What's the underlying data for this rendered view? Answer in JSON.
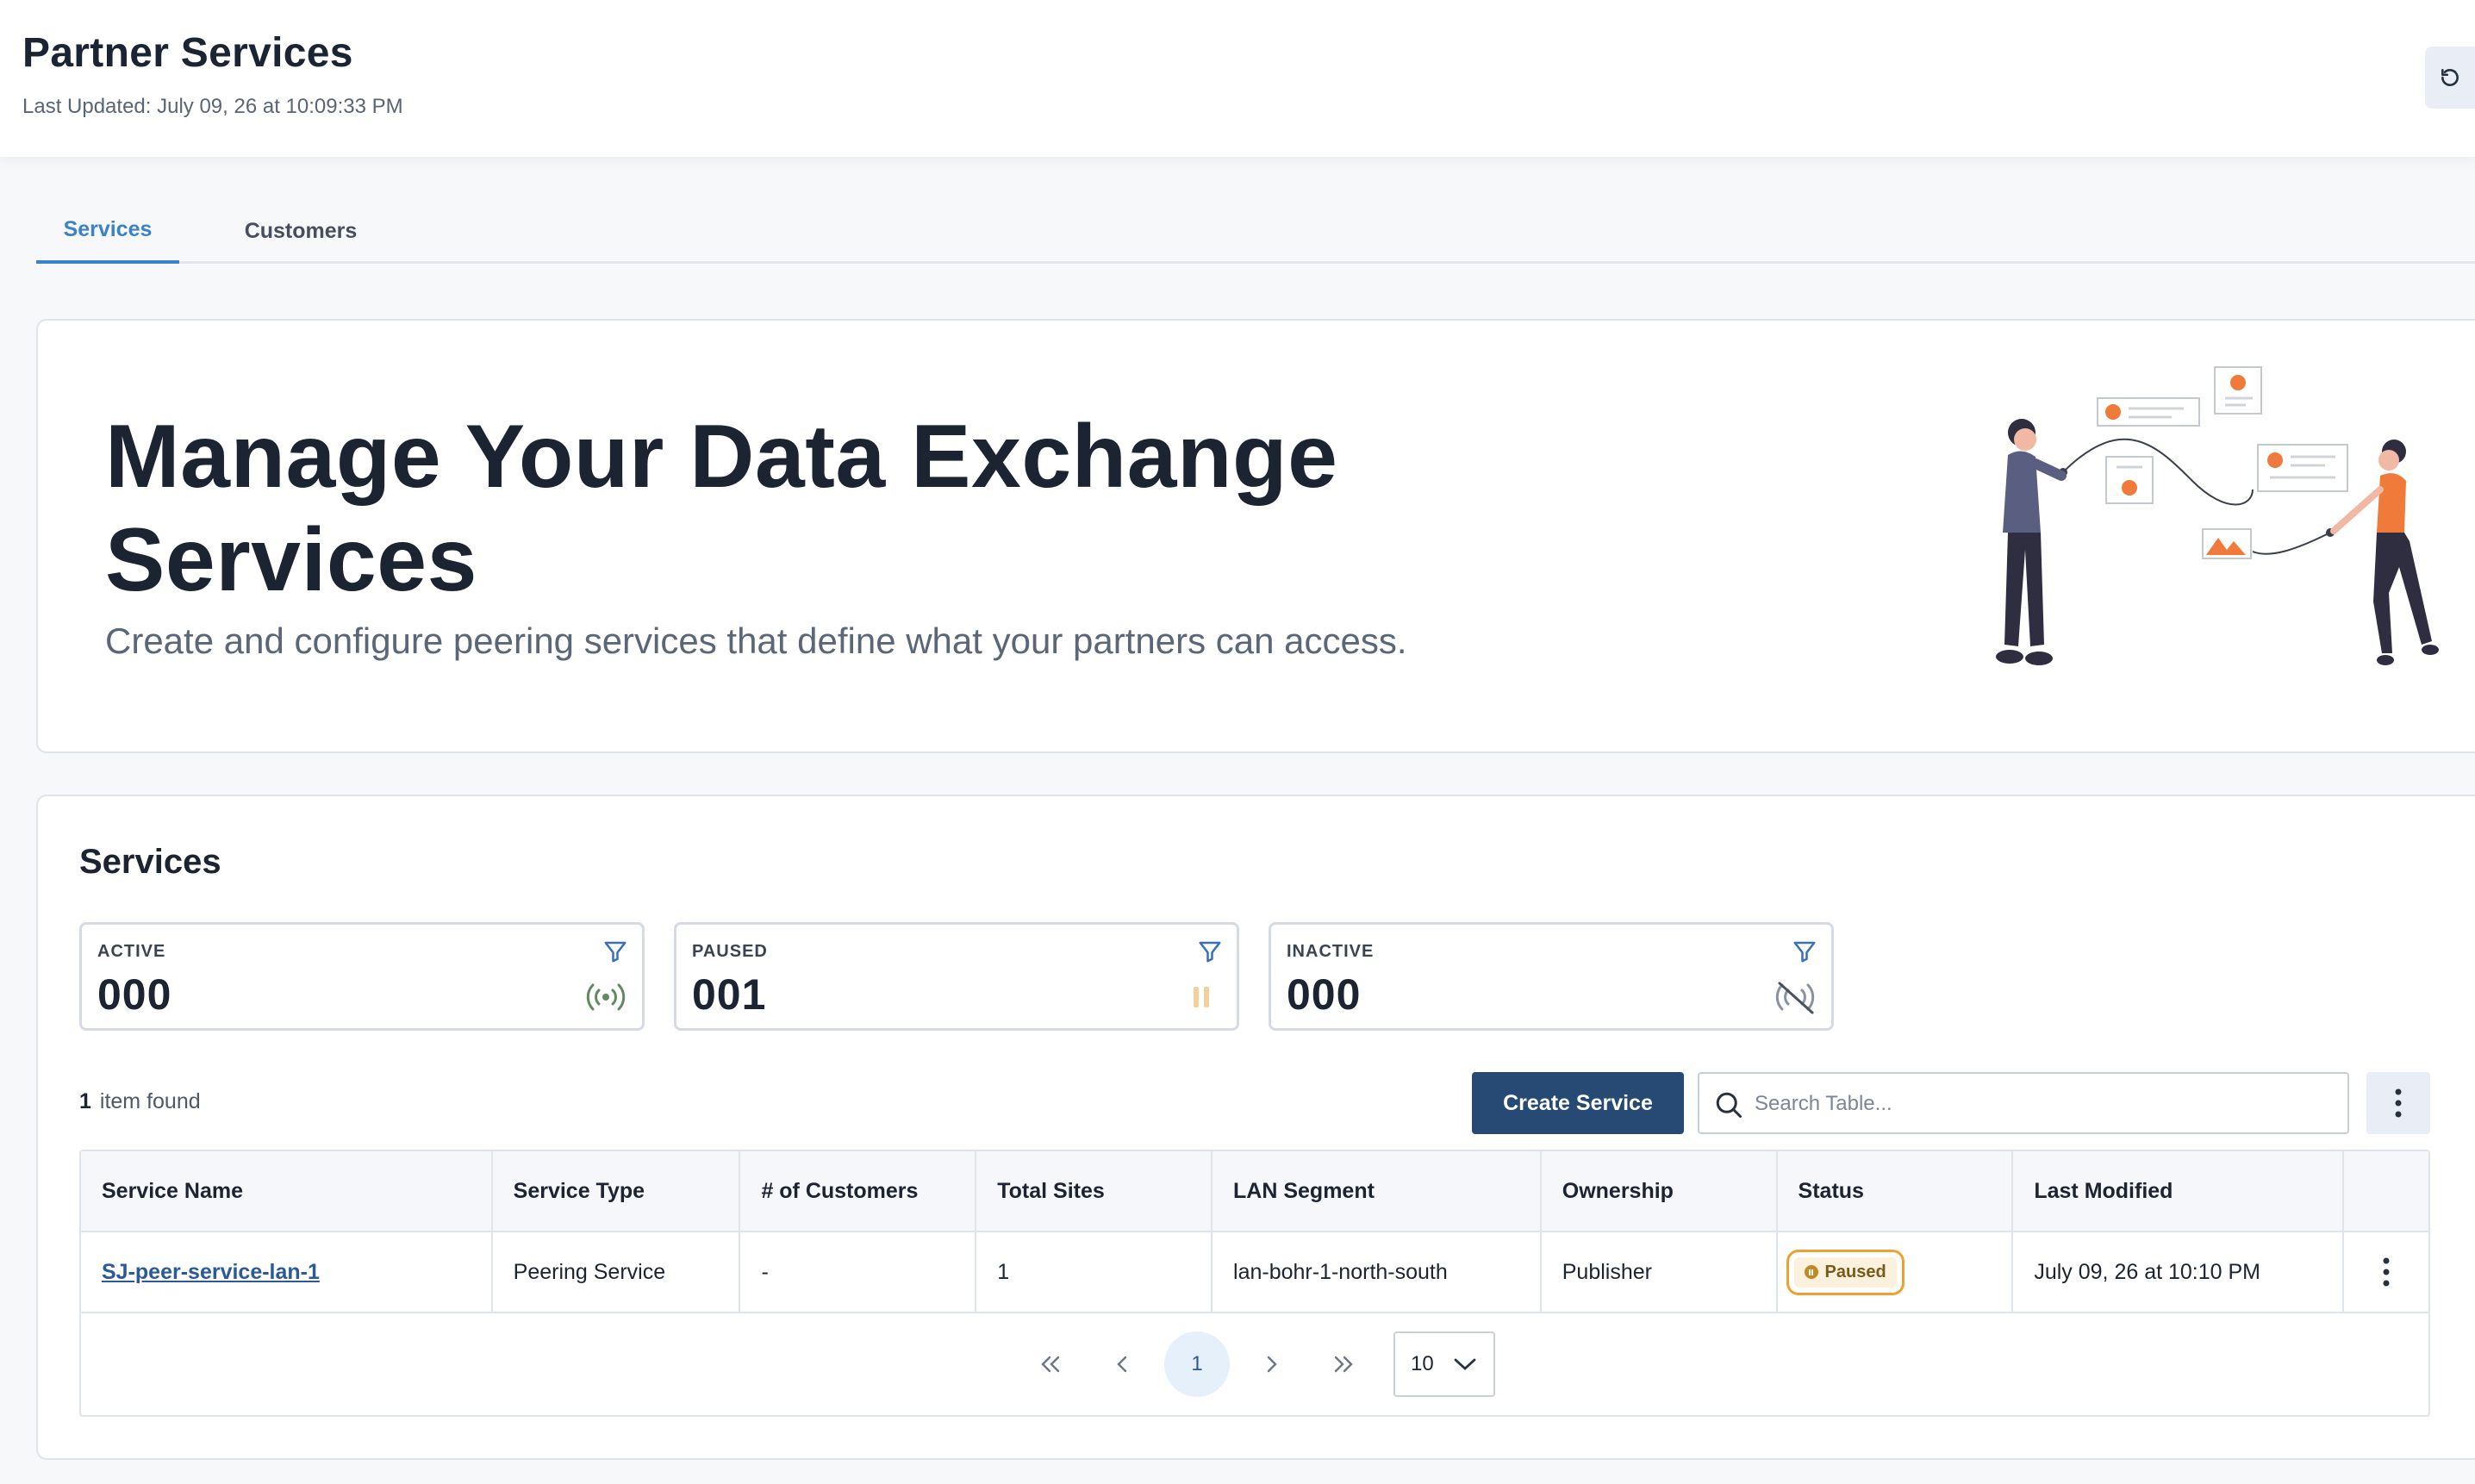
{
  "header": {
    "title": "Partner Services",
    "last_updated": "Last Updated: July 09, 26 at 10:09:33 PM",
    "refresh_icon": "refresh-icon"
  },
  "tabs": [
    {
      "label": "Services",
      "active": true
    },
    {
      "label": "Customers",
      "active": false
    }
  ],
  "hero": {
    "title": "Manage Your Data Exchange Services",
    "subtitle": "Create and configure peering services that define what your partners can access.",
    "illustration": "people-connecting-data-illustration"
  },
  "services": {
    "title": "Services",
    "stats": [
      {
        "label": "ACTIVE",
        "value": "000",
        "icon": "broadcast-icon",
        "color": "#5e8a5e"
      },
      {
        "label": "PAUSED",
        "value": "001",
        "icon": "pause-icon",
        "color": "#f3cf9c"
      },
      {
        "label": "INACTIVE",
        "value": "000",
        "icon": "broadcast-off-icon",
        "color": "#8a929e"
      }
    ],
    "items_count": "1",
    "items_found_label": "item found",
    "create_button": "Create Service",
    "search_placeholder": "Search Table...",
    "table": {
      "columns": [
        "Service Name",
        "Service Type",
        "# of Customers",
        "Total Sites",
        "LAN Segment",
        "Ownership",
        "Status",
        "Last Modified"
      ],
      "rows": [
        {
          "service_name": "SJ-peer-service-lan-1",
          "service_type": "Peering Service",
          "customers": "-",
          "total_sites": "1",
          "lan_segment": "lan-bohr-1-north-south",
          "ownership": "Publisher",
          "status": "Paused",
          "last_modified": "July 09, 26 at 10:10 PM"
        }
      ]
    },
    "pagination": {
      "current_page": "1",
      "page_size": "10"
    }
  },
  "colors": {
    "primary_button": "#264a73",
    "tab_active": "#3b82c9",
    "status_paused_border": "#f0a033",
    "accent_orange": "#ef7a3a"
  }
}
